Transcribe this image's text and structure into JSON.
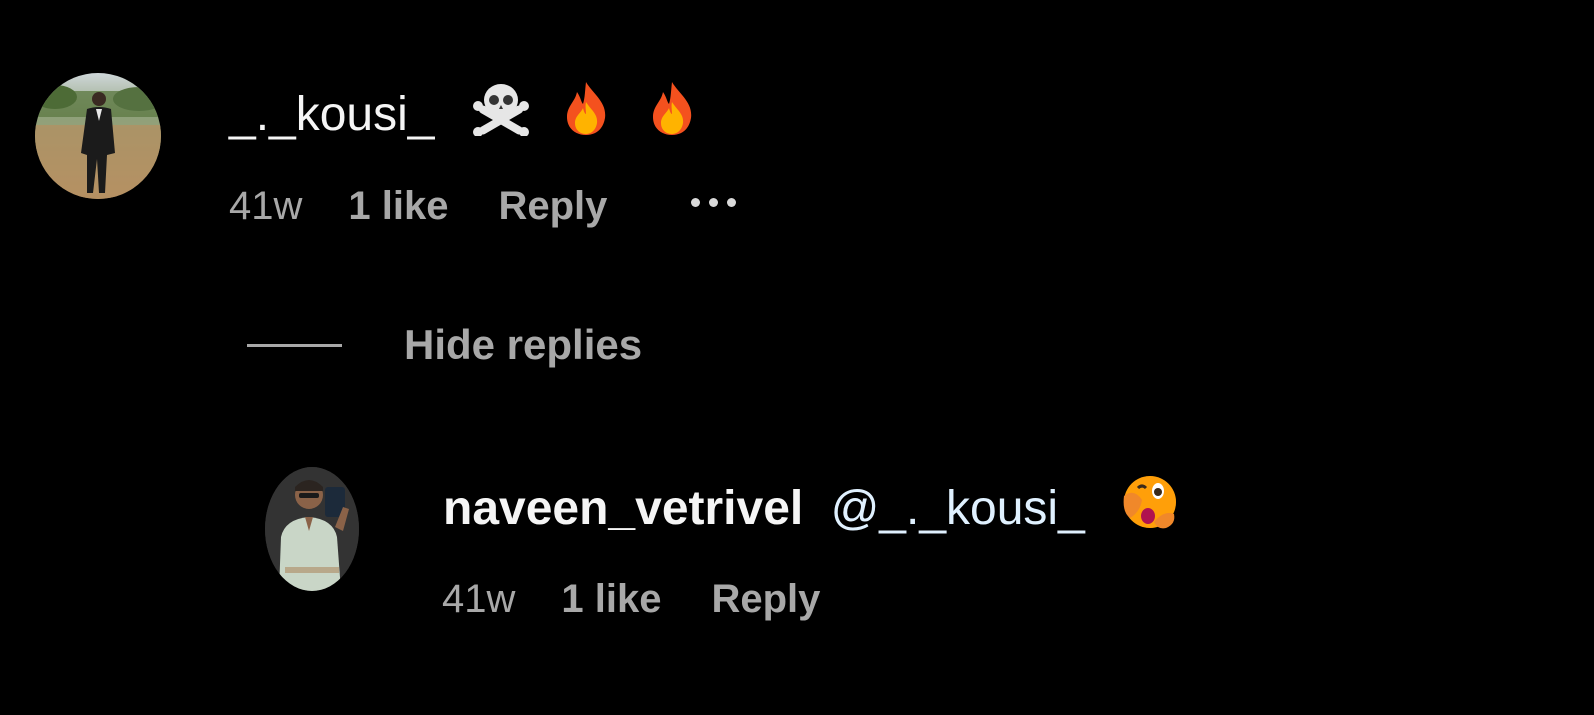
{
  "comments": [
    {
      "username": "_._kousi_",
      "text_emojis": [
        "skull-and-crossbones",
        "fire",
        "fire"
      ],
      "time": "41w",
      "likes": "1 like",
      "reply_label": "Reply"
    }
  ],
  "replies_toggle": {
    "label": "Hide replies"
  },
  "replies": [
    {
      "username": "naveen_vetrivel",
      "mention": "@_._kousi_",
      "text_emojis": [
        "face-with-open-eyes-and-hand-over-mouth"
      ],
      "time": "41w",
      "likes": "1 like",
      "reply_label": "Reply"
    }
  ],
  "icons": {
    "more": "more-options-icon",
    "skull": "skull-and-crossbones-icon",
    "fire": "fire-icon",
    "shocked": "face-hand-over-mouth-icon"
  },
  "colors": {
    "background": "#000000",
    "primary_text": "#f5f5f5",
    "secondary_text": "#a8a8a8",
    "mention": "#e0f1ff"
  }
}
